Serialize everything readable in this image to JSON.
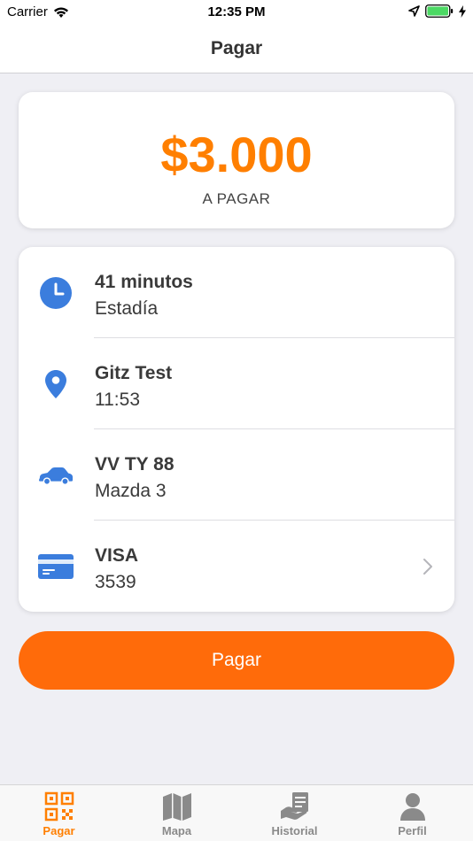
{
  "status_bar": {
    "carrier": "Carrier",
    "time": "12:35 PM"
  },
  "nav": {
    "title": "Pagar"
  },
  "amount": {
    "value": "$3.000",
    "label": "A PAGAR"
  },
  "details": [
    {
      "icon": "clock-icon",
      "title": "41 minutos",
      "subtitle": "Estadía"
    },
    {
      "icon": "location-pin-icon",
      "title": "Gitz Test",
      "subtitle": "11:53"
    },
    {
      "icon": "car-icon",
      "title": "VV TY 88",
      "subtitle": "Mazda 3"
    },
    {
      "icon": "credit-card-icon",
      "title": "VISA",
      "subtitle": "3539"
    }
  ],
  "pay_button": {
    "label": "Pagar"
  },
  "tabs": [
    {
      "icon": "qr-code-icon",
      "label": "Pagar",
      "active": true
    },
    {
      "icon": "map-icon",
      "label": "Mapa",
      "active": false
    },
    {
      "icon": "history-icon",
      "label": "Historial",
      "active": false
    },
    {
      "icon": "profile-icon",
      "label": "Perfil",
      "active": false
    }
  ],
  "colors": {
    "accent": "#ff7f00",
    "button": "#ff6b0a",
    "icon_blue": "#3b7ddd",
    "tab_inactive": "#8a8a8a"
  }
}
